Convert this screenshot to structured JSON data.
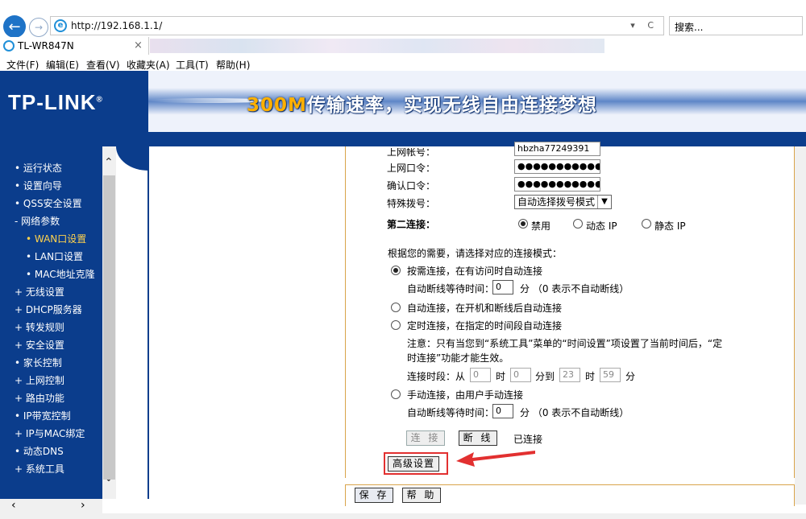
{
  "browser": {
    "url": "http://192.168.1.1/",
    "addr_controls": "▾ C",
    "search_placeholder": "搜索...",
    "tab_title": "TL-WR847N",
    "tab_close": "×",
    "menu": [
      "文件(F)",
      "编辑(E)",
      "查看(V)",
      "收藏夹(A)",
      "工具(T)",
      "帮助(H)"
    ]
  },
  "banner": {
    "logo": "TP-LINK",
    "logo_mark": "®",
    "slogan_num": "300M",
    "slogan_text": "传输速率，实现无线自由连接梦想"
  },
  "sidebar": {
    "items": [
      {
        "label": "• 运行状态"
      },
      {
        "label": "• 设置向导"
      },
      {
        "label": "• QSS安全设置"
      },
      {
        "label": "- 网络参数"
      },
      {
        "label": "• WAN口设置",
        "sub": true,
        "selected": true
      },
      {
        "label": "• LAN口设置",
        "sub": true
      },
      {
        "label": "• MAC地址克隆",
        "sub": true
      },
      {
        "label": "+ 无线设置"
      },
      {
        "label": "+ DHCP服务器"
      },
      {
        "label": "+ 转发规则"
      },
      {
        "label": "+ 安全设置"
      },
      {
        "label": "• 家长控制"
      },
      {
        "label": "+ 上网控制"
      },
      {
        "label": "+ 路由功能"
      },
      {
        "label": "• IP带宽控制"
      },
      {
        "label": "+ IP与MAC绑定"
      },
      {
        "label": "• 动态DNS"
      },
      {
        "label": "+ 系统工具"
      }
    ]
  },
  "form": {
    "account_label": "上网帐号：",
    "account_value": "hbzha77249391",
    "password_label": "上网口令：",
    "password_value": "●●●●●●●●●●●●●",
    "confirm_label": "确认口令：",
    "confirm_value": "●●●●●●●●●●●●●",
    "dial_label": "特殊拨号：",
    "dial_value": "自动选择拨号模式",
    "second_label": "第二连接：",
    "second_options": [
      "禁用",
      "动态 IP",
      "静态 IP"
    ],
    "mode_prompt": "根据您的需要，请选择对应的连接模式：",
    "opt_demand": "按需连接，在有访问时自动连接",
    "idle_label": "自动断线等待时间：",
    "idle_value": "0",
    "idle_unit": "分  （0 表示不自动断线）",
    "opt_auto": "自动连接，在开机和断线后自动连接",
    "opt_timed": "定时连接，在指定的时间段自动连接",
    "timed_note_1": "注意：只有当您到“系统工具”菜单的“时间设置”项设置了当前时间后，“定",
    "timed_note_2": "时连接”功能才能生效。",
    "period_label": "连接时段：从",
    "period_from_h": "0",
    "hour_unit": "时",
    "period_from_m": "0",
    "to_label": "分到",
    "period_to_h": "23",
    "period_to_m": "59",
    "min_unit": "分",
    "opt_manual": "手动连接，由用户手动连接",
    "idle2_value": "0",
    "connect_btn": "连 接",
    "disconnect_btn": "断 线",
    "status": "已连接",
    "advanced_btn": "高级设置",
    "save_btn": "保 存",
    "help_btn": "帮 助"
  },
  "colors": {
    "brand_blue": "#0b3d8c",
    "highlight_red": "#e23030",
    "panel_border": "#d9a44a"
  }
}
